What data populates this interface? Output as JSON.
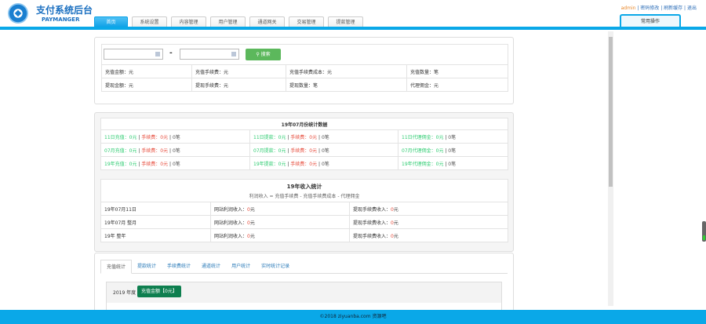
{
  "header": {
    "title": "支付系统后台",
    "subtitle": "PAYMANGER",
    "nav": [
      "首页",
      "系统设置",
      "内容管理",
      "用户管理",
      "通道网关",
      "交易管理",
      "提款管理"
    ],
    "user": "admin",
    "links": [
      "密码修改",
      "刷新缓存",
      "退出"
    ],
    "quick": "常用操作"
  },
  "search": {
    "sep": "-",
    "button": "搜索",
    "rows": [
      [
        "充值金额：元",
        "充值手续费：元",
        "充值手续费成本：元",
        "充值数量：笔"
      ],
      [
        "提现金额：元",
        "提现手续费：元",
        "提现数量：笔",
        "代理佣金：元"
      ]
    ]
  },
  "monthly": {
    "title": "19年07月份统计数据",
    "rows": [
      [
        {
          "a": "11日充值：0元",
          "b": "手续费：0元",
          "c": "0笔"
        },
        {
          "a": "11日提款：0元",
          "b": "手续费：0元",
          "c": "0笔"
        },
        {
          "a": "11日代理佣金：0元",
          "c": "0笔"
        }
      ],
      [
        {
          "a": "07月充值：0元",
          "b": "手续费：0元",
          "c": "0笔"
        },
        {
          "a": "07月提款：0元",
          "b": "手续费：0元",
          "c": "0笔"
        },
        {
          "a": "07月代理佣金：0元",
          "c": "0笔"
        }
      ],
      [
        {
          "a": "19年充值：0元",
          "b": "手续费：0元",
          "c": "0笔"
        },
        {
          "a": "19年提款：0元",
          "b": "手续费：0元",
          "c": "0笔"
        },
        {
          "a": "19年代理佣金：0元",
          "c": "0笔"
        }
      ]
    ]
  },
  "income": {
    "title": "19年收入统计",
    "formula": "利润收入 = 充值手续费 - 充值手续费成本 - 代理佣金",
    "rows": [
      [
        "19年07月11日",
        "网站利润收入：",
        "0",
        "元",
        "提现手续费收入：",
        "0",
        "元"
      ],
      [
        "19年07月 整月",
        "网站利润收入：",
        "0",
        "元",
        "提现手续费收入：",
        "0",
        "元"
      ],
      [
        "19年 整年",
        "网站利润收入：",
        "0",
        "元",
        "提现手续费收入：",
        "0",
        "元"
      ]
    ]
  },
  "tabs": [
    "充值统计",
    "提款统计",
    "手续费统计",
    "通道统计",
    "用户统计",
    "实时统计记录"
  ],
  "year_box": {
    "label": "2019 年度",
    "badge": "充值金额【0元】"
  },
  "footer": "©2018 ziyuanba.com 资源吧",
  "colors": {
    "accent": "#0aa8e8",
    "green": "#2ecc71",
    "red": "#e74c3c",
    "search": "#5cb85c",
    "badge": "#0e7f4f"
  }
}
